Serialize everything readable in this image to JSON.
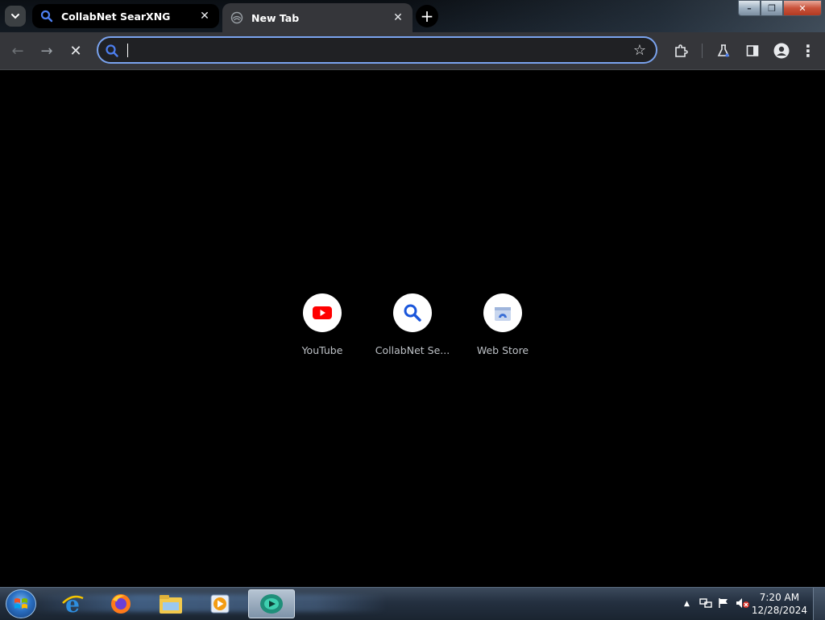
{
  "browser": {
    "tab_search_icon": "chevron-down-icon",
    "tabs": [
      {
        "title": "CollabNet SearXNG",
        "icon": "search-icon",
        "active": false
      },
      {
        "title": "New Tab",
        "icon": "new-tab-icon",
        "active": true
      }
    ],
    "new_tab_label": "+",
    "window_controls": {
      "minimize": "–",
      "maximize": "❐",
      "close": "✕"
    }
  },
  "toolbar": {
    "back": "←",
    "forward": "→",
    "stop": "✕",
    "omnibox": {
      "value": "",
      "placeholder": ""
    },
    "bookmark_star": "☆",
    "extensions": "extensions-icon",
    "labs": "labs-icon",
    "side_panel": "side-panel-icon",
    "profile": "profile-icon",
    "menu": "⋮"
  },
  "shortcuts": [
    {
      "label": "YouTube",
      "icon": "youtube-icon"
    },
    {
      "label": "CollabNet Se...",
      "icon": "search-icon"
    },
    {
      "label": "Web Store",
      "icon": "web-store-icon"
    }
  ],
  "taskbar": {
    "start": "start-orb-icon",
    "apps": [
      {
        "name": "internet-explorer-icon"
      },
      {
        "name": "firefox-icon"
      },
      {
        "name": "file-explorer-icon"
      },
      {
        "name": "media-player-icon"
      },
      {
        "name": "browser-app-icon",
        "active": true
      }
    ],
    "tray": {
      "show_hidden": "▲",
      "clock_time": "7:20 AM",
      "clock_date": "12/28/2024"
    }
  },
  "colors": {
    "accent": "#7aa3ee",
    "toolbar_bg": "#35363a",
    "page_bg": "#000000",
    "youtube_red": "#ff0000",
    "search_blue": "#1a56db"
  }
}
